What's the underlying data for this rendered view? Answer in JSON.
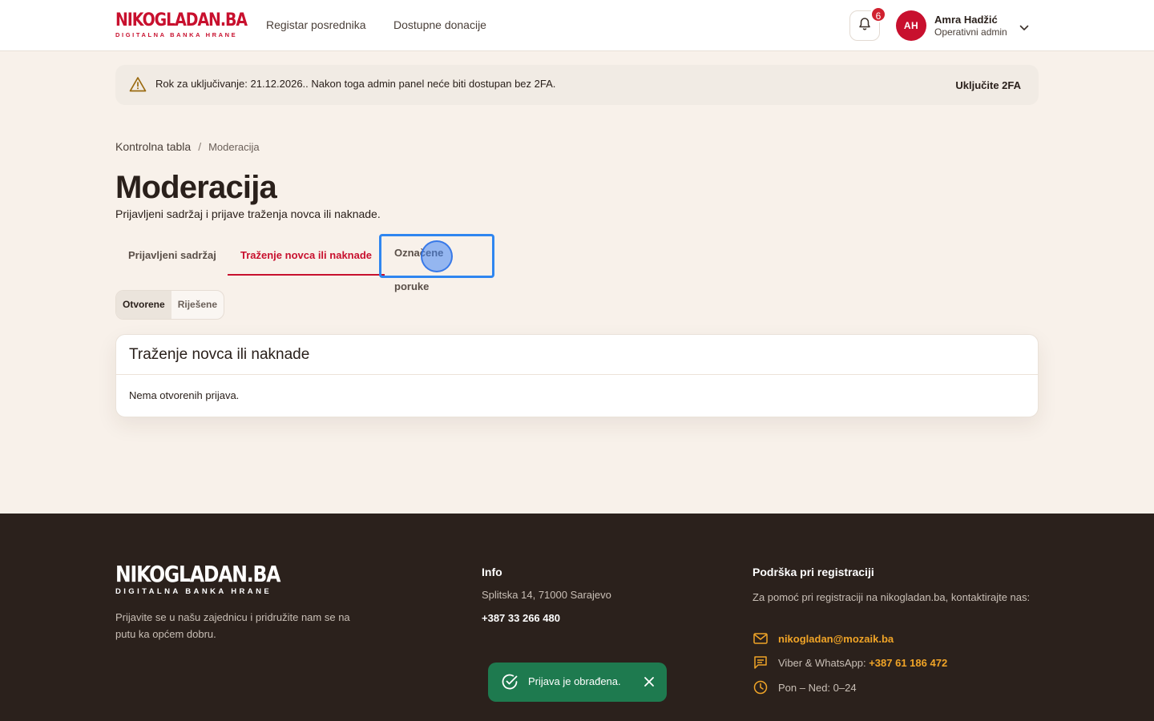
{
  "header": {
    "logo_main_dark": "NIKO",
    "logo_main_rest": "GLADAN.BA",
    "logo_tagline": "DIGITALNA BANKA HRANE",
    "nav": [
      "Registar posrednika",
      "Dostupne donacije"
    ],
    "notifications_count": "6",
    "user": {
      "initials": "AH",
      "name": "Amra Hadžić",
      "role": "Operativni admin"
    }
  },
  "alert": {
    "text": "Rok za uključivanje: 21.12.2026.. Nakon toga admin panel neće biti dostupan bez 2FA.",
    "action": "Uključite 2FA"
  },
  "breadcrumb": {
    "parent": "Kontrolna tabla",
    "separator": "/",
    "current": "Moderacija"
  },
  "page": {
    "title": "Moderacija",
    "subtitle": "Prijavljeni sadržaj i prijave traženja novca ili naknade."
  },
  "tabs": [
    {
      "label": "Prijavljeni sadržaj"
    },
    {
      "label": "Traženje novca ili naknade"
    },
    {
      "label": "Označene poruke"
    }
  ],
  "filters": [
    {
      "label": "Otvorene"
    },
    {
      "label": "Riješene"
    }
  ],
  "card": {
    "title": "Traženje novca ili naknade",
    "empty_text": "Nema otvorenih prijava."
  },
  "footer": {
    "logo_name": "NIKOGLADAN.BA",
    "logo_tagline": "DIGITALNA BANKA HRANE",
    "description": "Prijavite se u našu zajednicu i pridružite nam se na putu ka općem dobru.",
    "info_heading": "Info",
    "address": "Splitska 14, 71000 Sarajevo",
    "phone": "+387 33 266 480",
    "support_heading": "Podrška pri registraciji",
    "support_desc": "Za pomoć pri registraciji na nikogladan.ba, kontaktirajte nas:",
    "email": "nikogladan@mozaik.ba",
    "viber_label": "Viber & WhatsApp:",
    "viber_number": "+387 61 186 472",
    "hours": "Pon – Ned: 0–24"
  },
  "toast": {
    "text": "Prijava je obrađena."
  },
  "colors": {
    "brand_red": "#c8102e",
    "focus_blue": "#2f86f0",
    "footer_bg": "#2b211c",
    "accent_orange": "#f0a427",
    "toast_green": "#1e7a4f"
  }
}
